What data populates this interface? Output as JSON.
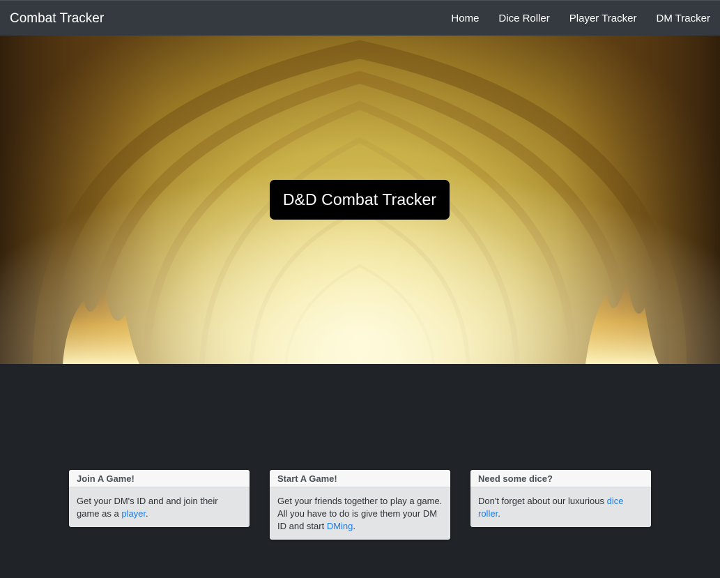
{
  "navbar": {
    "brand": "Combat Tracker",
    "links": [
      "Home",
      "Dice Roller",
      "Player Tracker",
      "DM Tracker"
    ],
    "background": "#343a40"
  },
  "hero": {
    "title": "D&D Combat Tracker"
  },
  "cards": [
    {
      "header": "Join A Game!",
      "text_before": "Get your DM's ID and and join their game as a ",
      "link": "player",
      "text_after": "."
    },
    {
      "header": "Start A Game!",
      "text_before": "Get your friends together to play a game. All you have to do is give them your DM ID and start ",
      "link": "DMing",
      "text_after": "."
    },
    {
      "header": "Need some dice?",
      "text_before": "Don't forget about our luxurious ",
      "link": "dice roller",
      "text_after": "."
    }
  ],
  "colors": {
    "page_background": "#202328",
    "link": "#1f7ae6",
    "card_body": "#e2e4e5"
  }
}
